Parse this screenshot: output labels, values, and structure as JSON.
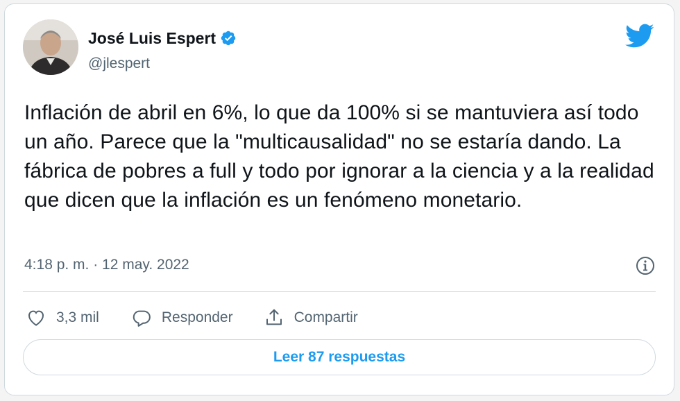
{
  "author": {
    "name": "José Luis Espert",
    "handle": "@jlespert",
    "verified": true,
    "avatar_icon": "avatar-photo"
  },
  "tweet": {
    "text": "Inflación de abril en 6%, lo que da 100% si se mantuviera así todo un año. Parece que la \"multicausalidad\" no se estaría dando. La fábrica de pobres a full y todo por ignorar a la ciencia y a la realidad que dicen que la inflación es un fenómeno monetario.",
    "timestamp": "4:18 p. m. · 12 may. 2022"
  },
  "actions": {
    "like_count": "3,3 mil",
    "reply_label": "Responder",
    "share_label": "Compartir"
  },
  "footer": {
    "read_replies_label": "Leer 87 respuestas"
  },
  "colors": {
    "brand": "#1d9bf0",
    "text": "#0f1419",
    "secondary": "#536471",
    "border": "#cfd9de"
  },
  "icons": [
    "twitter-bird-icon",
    "verified-badge-icon",
    "info-icon",
    "heart-icon",
    "reply-bubble-icon",
    "share-icon"
  ]
}
